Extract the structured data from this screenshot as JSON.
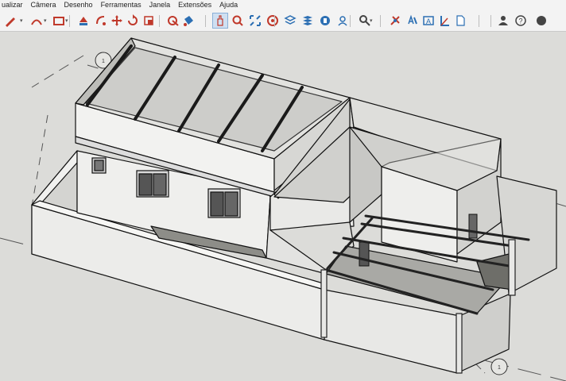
{
  "menu": {
    "items": [
      "ualizar",
      "Câmera",
      "Desenho",
      "Ferramentas",
      "Janela",
      "Extensões",
      "Ajuda"
    ]
  },
  "toolbar": {
    "tools": [
      {
        "name": "pencil-icon",
        "color": "#c0392b"
      },
      {
        "name": "arc-icon",
        "color": "#c0392b"
      },
      {
        "name": "rectangle-icon",
        "color": "#c0392b"
      },
      {
        "name": "push-pull-icon",
        "color": "#c0392b"
      },
      {
        "name": "follow-me-icon",
        "color": "#c0392b"
      },
      {
        "name": "move-icon",
        "color": "#c0392b"
      },
      {
        "name": "rotate-icon",
        "color": "#c0392b"
      },
      {
        "name": "scale-icon",
        "color": "#c0392b"
      },
      {
        "name": "tape-measure-icon",
        "color": "#c0392b"
      },
      {
        "name": "paint-bucket-icon",
        "color": "#2c6fb3"
      },
      {
        "name": "orbit-icon",
        "color": "#c0392b"
      },
      {
        "name": "pan-icon",
        "color": "#c0392b"
      },
      {
        "name": "zoom-icon",
        "color": "#2c6fb3"
      },
      {
        "name": "zoom-extents-icon",
        "color": "#c0392b"
      },
      {
        "name": "geo-location-icon",
        "color": "#2c6fb3"
      },
      {
        "name": "sandbox-icon",
        "color": "#2c6fb3"
      },
      {
        "name": "layers-icon",
        "color": "#2c6fb3"
      },
      {
        "name": "styles-icon",
        "color": "#2c6fb3"
      },
      {
        "name": "account-icon",
        "color": "#444444"
      },
      {
        "name": "section-plane-icon",
        "color": "#c0392b"
      },
      {
        "name": "walk-icon",
        "color": "#2c6fb3"
      },
      {
        "name": "eraser-icon",
        "color": "#2c6fb3"
      },
      {
        "name": "text-icon",
        "color": "#2c6fb3"
      },
      {
        "name": "axes-icon",
        "color": "#2c6fb3"
      },
      {
        "name": "new-file-icon",
        "color": "#444444"
      },
      {
        "name": "user-icon",
        "color": "#444444"
      },
      {
        "name": "help-icon",
        "color": "#444444"
      }
    ],
    "active_tool": "orbit-icon"
  },
  "viewport": {
    "background": "#dcdcd9",
    "section_marker_labels": [
      "1",
      "1"
    ]
  }
}
